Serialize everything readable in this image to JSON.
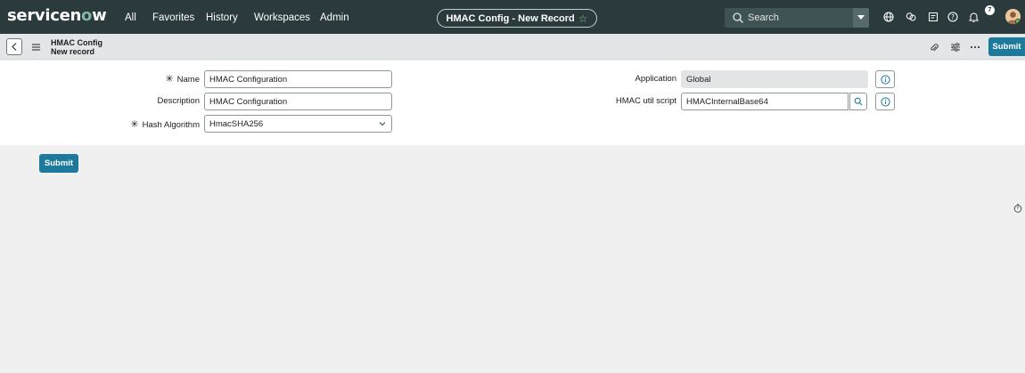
{
  "topnav": {
    "logo_main": "servicen",
    "logo_accent": "o",
    "logo_end": "w",
    "items": [
      "All",
      "Favorites",
      "History",
      "Workspaces",
      "Admin"
    ],
    "record_title": "HMAC Config - New Record",
    "search_placeholder": "Search",
    "notification_count": "7"
  },
  "formbar": {
    "table_name": "HMAC Config",
    "record_state": "New record",
    "submit_label": "Submit"
  },
  "form": {
    "name_label": "Name",
    "name_value": "HMAC Configuration",
    "description_label": "Description",
    "description_value": "HMAC Configuration",
    "hash_label": "Hash Algorithm",
    "hash_value": "HmacSHA256",
    "application_label": "Application",
    "application_value": "Global",
    "util_label": "HMAC util script",
    "util_value": "HMACInternalBase64",
    "required_marker": "✳"
  },
  "footer": {
    "submit_label": "Submit"
  },
  "colors": {
    "nav_bg": "#2a3a3d",
    "accent": "#81b5a1",
    "primary_button": "#1d7a9c"
  },
  "icons": [
    "search-icon",
    "dropdown-arrow-icon",
    "globe-icon",
    "chat-icon",
    "list-icon",
    "help-icon",
    "bell-icon",
    "back-icon",
    "menu-icon",
    "paperclip-icon",
    "sliders-icon",
    "more-icon",
    "chevron-down-icon",
    "info-icon",
    "timer-icon"
  ]
}
